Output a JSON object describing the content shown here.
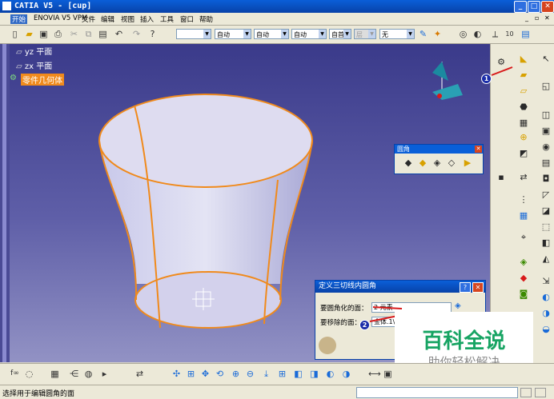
{
  "window": {
    "title": "CATIA V5 - [cup]",
    "min": "_",
    "max": "□",
    "close": "✕"
  },
  "menu": {
    "items": [
      "开始",
      "ENOVIA V5 VPM",
      "文件",
      "编辑",
      "视图",
      "插入",
      "工具",
      "窗口",
      "帮助"
    ]
  },
  "toolbar": {
    "combo_line": "",
    "combo_auto1": "自动",
    "combo_auto2": "自动",
    "combo_auto3": "自动",
    "combo_auto4": "自动",
    "combo_auto5": "自首",
    "combo_layer": "层",
    "combo_none": "无"
  },
  "tree": {
    "yz": "yz 平面",
    "zx": "zx 平面",
    "body": "零件几何体"
  },
  "fillet_toolbar": {
    "title": "圆角",
    "close": "✕"
  },
  "dialog": {
    "title": "定义三切线内圆角",
    "help": "?",
    "close": "✕",
    "faces_label": "要圆角化的面：",
    "faces_value": "2 元素",
    "remove_label": "要移除的面：",
    "remove_value": "金体.1\\"
  },
  "watermark": {
    "main": "百科全说",
    "sub": "助你轻松解决"
  },
  "callouts": {
    "one": "1",
    "two": "2"
  },
  "statusbar": {
    "message": "选择用于编辑圆角的面"
  },
  "colors": {
    "accent": "#0a5fd8",
    "highlight": "#f08a1c",
    "brand_green": "#17a463"
  }
}
